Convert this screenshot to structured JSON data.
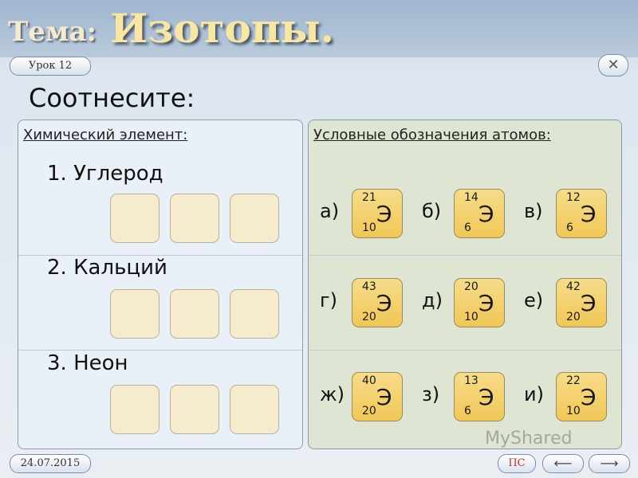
{
  "header": {
    "tema": "Тема:",
    "topic": "Изотопы."
  },
  "lesson": "Урок 12",
  "close": "✕",
  "instruction": "Соотнесите:",
  "left_panel": {
    "heading": "Химический элемент:",
    "elements": [
      {
        "label": "1. Углерод"
      },
      {
        "label": "2. Кальций"
      },
      {
        "label": "3. Неон"
      }
    ]
  },
  "right_panel": {
    "heading": "Условные обозначения атомов:",
    "options": [
      {
        "letter": "а)",
        "mass": "21",
        "number": "10",
        "symbol": "Э"
      },
      {
        "letter": "б)",
        "mass": "14",
        "number": "6",
        "symbol": "Э"
      },
      {
        "letter": "в)",
        "mass": "12",
        "number": "6",
        "symbol": "Э"
      },
      {
        "letter": "г)",
        "mass": "43",
        "number": "20",
        "symbol": "Э"
      },
      {
        "letter": "д)",
        "mass": "20",
        "number": "10",
        "symbol": "Э"
      },
      {
        "letter": "е)",
        "mass": "42",
        "number": "20",
        "symbol": "Э"
      },
      {
        "letter": "ж)",
        "mass": "40",
        "number": "20",
        "symbol": "Э"
      },
      {
        "letter": "з)",
        "mass": "13",
        "number": "6",
        "symbol": "Э"
      },
      {
        "letter": "и)",
        "mass": "22",
        "number": "10",
        "symbol": "Э"
      }
    ]
  },
  "footer": {
    "date": "24.07.2015",
    "ps": "ПС",
    "prev": "⟵",
    "next": "⟶"
  },
  "watermark": "MyShared"
}
